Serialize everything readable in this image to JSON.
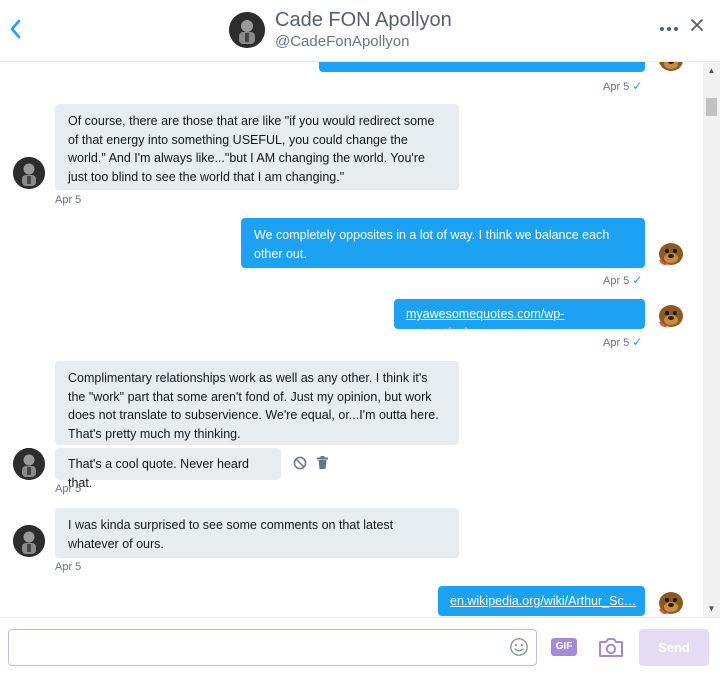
{
  "header": {
    "back_icon": "chevron-left-icon",
    "name": "Cade FON Apollyon",
    "handle": "@CadeFonApollyon",
    "more_icon": "more-horizontal-icon",
    "close_icon": "close-icon"
  },
  "messages": [
    {
      "direction": "out",
      "text": "",
      "stamp": "Apr 5",
      "read": true
    },
    {
      "direction": "in",
      "text": "Of course, there are those that are like \"if you would redirect some of that energy into something USEFUL, you could change the world.\" And I'm always like...\"but I AM changing the world. You're just too blind to see the world that I am changing.\"",
      "stamp": "Apr 5"
    },
    {
      "direction": "out",
      "text": "We completely opposites in a lot of way. I think we balance each other out.",
      "stamp": "Apr 5",
      "read": true
    },
    {
      "direction": "out",
      "link": "myawesomequotes.com/wp-content/upl…",
      "stamp": "Apr 5",
      "read": true
    },
    {
      "direction": "in",
      "text": "Complimentary relationships work as well as any other. I think it's the \"work\" part that some aren't fond of. Just my opinion, but work does not translate to subservience. We're equal, or...I'm outta here. That's pretty much my thinking."
    },
    {
      "direction": "in",
      "text": "That's a cool quote. Never heard that.",
      "stamp": "Apr 5",
      "actions": [
        "block-icon",
        "trash-icon"
      ]
    },
    {
      "direction": "in",
      "text": "I was kinda surprised to see some comments on that latest whatever of ours.",
      "stamp": "Apr 5"
    },
    {
      "direction": "out",
      "link": "en.wikipedia.org/wiki/Arthur_Sc…"
    }
  ],
  "read_mark": "✓",
  "composer": {
    "placeholder": "",
    "emoji_icon": "emoji-icon",
    "gif_label": "GIF",
    "camera_icon": "camera-icon",
    "send_label": "Send"
  },
  "colors": {
    "accent": "#1da1f2",
    "incoming_bubble": "#e6ecf0",
    "composer_accent": "#a58bd6"
  }
}
